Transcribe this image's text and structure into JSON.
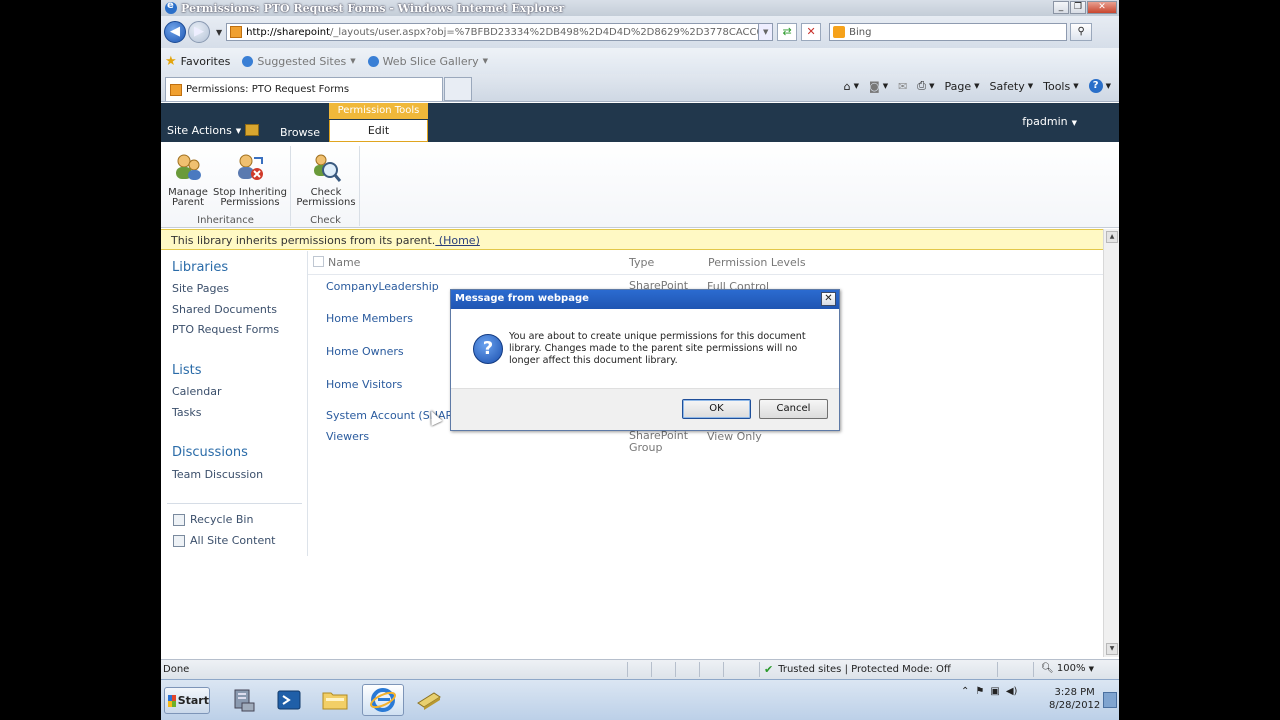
{
  "window": {
    "title": "Permissions: PTO Request Forms - Windows Internet Explorer",
    "controls": {
      "minimize": "_",
      "maximize": "❐",
      "close": "✕"
    }
  },
  "address_bar": {
    "url_host": "http://sharepoint",
    "url_path": "/_layouts/user.aspx?obj=%7BFBD23334%2DB498%2D4D4D%2D8629%2D3778CACC08E5%7D",
    "search_placeholder": "Bing"
  },
  "favorites_bar": {
    "favorites_label": "Favorites",
    "items": [
      {
        "label": "Suggested Sites"
      },
      {
        "label": "Web Slice Gallery"
      }
    ]
  },
  "tab": {
    "label": "Permissions: PTO Request Forms"
  },
  "command_bar": {
    "page": "Page",
    "safety": "Safety",
    "tools": "Tools"
  },
  "sharepoint_header": {
    "site_actions": "Site Actions",
    "browse_tab": "Browse",
    "context_group": "Permission Tools",
    "edit_tab": "Edit",
    "user": "fpadmin"
  },
  "ribbon": {
    "groups": [
      {
        "label": "Inheritance",
        "buttons": [
          {
            "line1": "Manage",
            "line2": "Parent"
          },
          {
            "line1": "Stop Inheriting",
            "line2": "Permissions"
          }
        ]
      },
      {
        "label": "Check",
        "buttons": [
          {
            "line1": "Check",
            "line2": "Permissions"
          }
        ]
      }
    ]
  },
  "info_bar": {
    "message": "This library inherits permissions from its parent.",
    "link": " (Home)"
  },
  "quick_launch": {
    "libraries_header": "Libraries",
    "libraries": [
      "Site Pages",
      "Shared Documents",
      "PTO Request Forms"
    ],
    "lists_header": "Lists",
    "lists": [
      "Calendar",
      "Tasks"
    ],
    "discussions_header": "Discussions",
    "discussions": [
      "Team Discussion"
    ],
    "utility": [
      "Recycle Bin",
      "All Site Content"
    ]
  },
  "permissions_list": {
    "columns": {
      "name": "Name",
      "type": "Type",
      "levels": "Permission Levels"
    },
    "rows": [
      {
        "name": "CompanyLeadership",
        "type": "SharePoint",
        "type2": "",
        "level": "Full Control"
      },
      {
        "name": "Home Members",
        "type": "",
        "type2": "",
        "level": ""
      },
      {
        "name": "Home Owners",
        "type": "",
        "type2": "",
        "level": ""
      },
      {
        "name": "Home Visitors",
        "type": "",
        "type2": "",
        "level": ""
      },
      {
        "name": "System Account (SHAREPO",
        "type": "",
        "type2": "",
        "level": ""
      },
      {
        "name": "Viewers",
        "type": "SharePoint",
        "type2": "Group",
        "level": "View Only"
      }
    ]
  },
  "dialog": {
    "title": "Message from webpage",
    "message": "You are about to create unique permissions for this document library. Changes made to the parent site permissions will no longer affect this document library.",
    "ok": "OK",
    "cancel": "Cancel"
  },
  "status_bar": {
    "status": "Done",
    "zone": "Trusted sites | Protected Mode: Off",
    "zoom": "100%"
  },
  "taskbar": {
    "start": "Start",
    "time": "3:28 PM",
    "date": "8/28/2012"
  }
}
